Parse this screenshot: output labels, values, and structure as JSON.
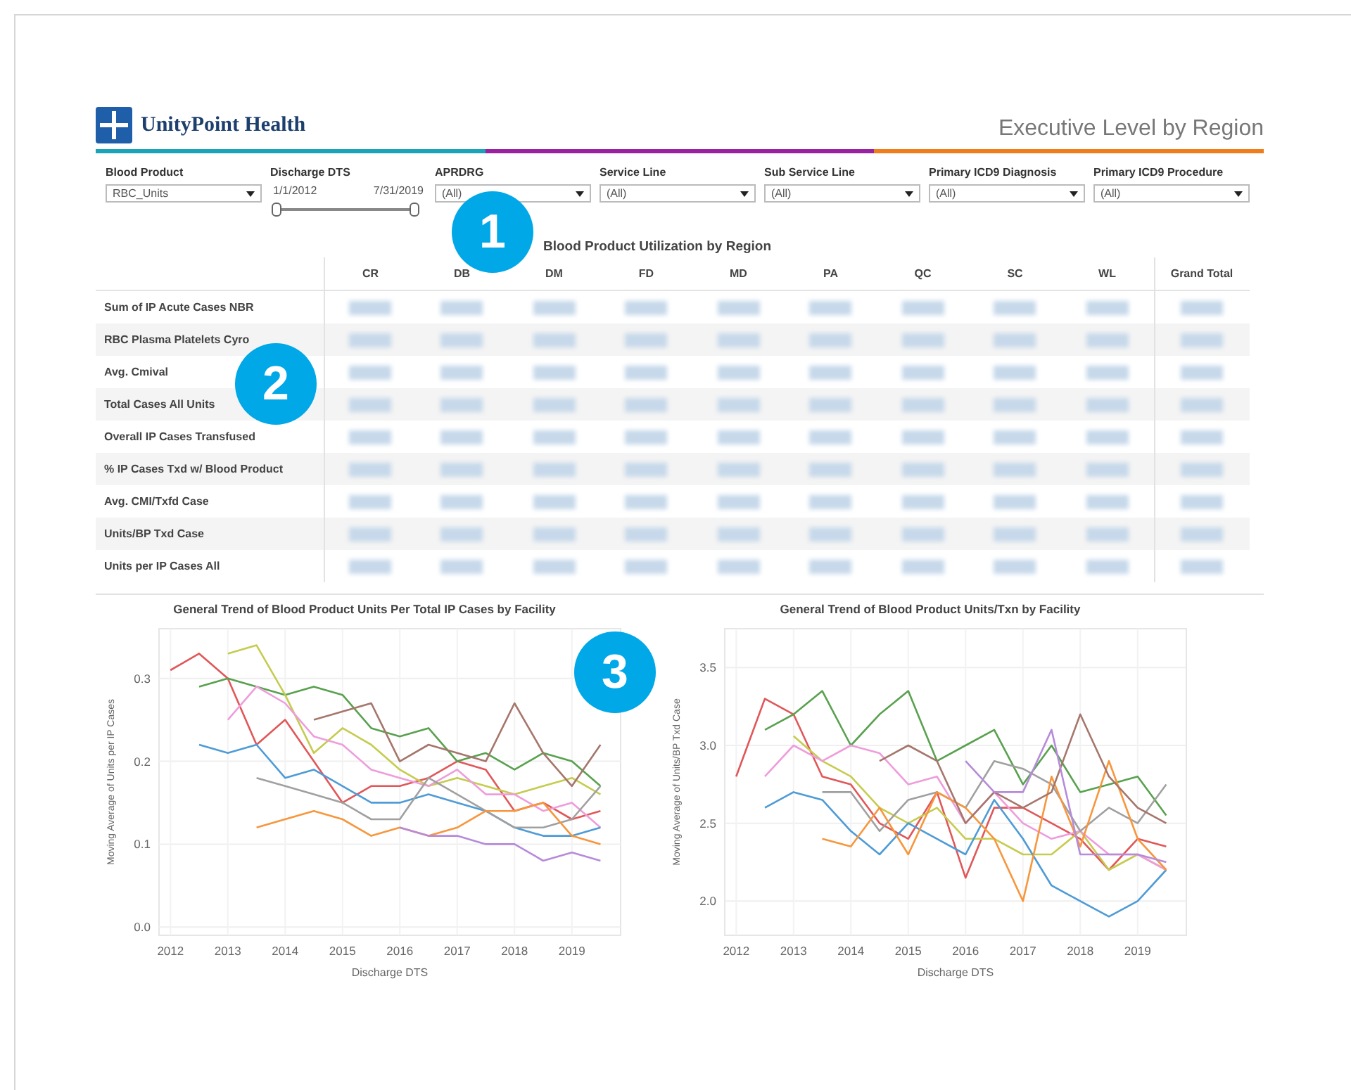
{
  "header": {
    "logo_text": "UnityPoint Health",
    "title": "Executive Level by Region"
  },
  "filters": [
    {
      "kind": "dropdown",
      "label": "Blood Product",
      "value": "RBC_Units"
    },
    {
      "kind": "range",
      "label": "Discharge DTS",
      "start": "1/1/2012",
      "end": "7/31/2019",
      "handles": [
        {
          "level": 0
        },
        {
          "level": 1
        }
      ]
    },
    {
      "kind": "dropdown",
      "label": "APRDRG",
      "value": "(All)"
    },
    {
      "kind": "dropdown",
      "label": "Service Line",
      "value": "(All)"
    },
    {
      "kind": "dropdown",
      "label": "Sub Service Line",
      "value": "(All)"
    },
    {
      "kind": "dropdown",
      "label": "Primary ICD9 Diagnosis",
      "value": "(All)"
    },
    {
      "kind": "dropdown",
      "label": "Primary ICD9 Procedure",
      "value": "(All)"
    }
  ],
  "table": {
    "title": "Blood Product Utilization by Region",
    "columns": [
      "CR",
      "DB",
      "DM",
      "FD",
      "MD",
      "PA",
      "QC",
      "SC",
      "WL",
      "Grand Total"
    ],
    "rows": [
      "Sum of IP Acute Cases NBR",
      "RBC Plasma Platelets Cyro",
      "Avg. Cmival",
      "Total Cases All Units",
      "Overall IP Cases Transfused",
      "% IP Cases Txd w/ Blood Product",
      "Avg. CMI/Txfd Case",
      "Units/BP Txd Case",
      "Units per IP Cases All"
    ]
  },
  "charts": [
    {
      "title": "General Trend of Blood Product Units Per Total IP Cases by Facility",
      "chart_data": {
        "type": "line",
        "grid": true,
        "xlabel": "Discharge DTS",
        "ylabel": "Moving Average of Units per IP Cases",
        "x": [
          2012,
          2012.5,
          2013,
          2013.5,
          2014,
          2014.5,
          2015,
          2015.5,
          2016,
          2016.5,
          2017,
          2017.5,
          2018,
          2018.5,
          2019,
          2019.5
        ],
        "xlim": [
          2011.8,
          2019.85
        ],
        "ylim": [
          -0.01,
          0.36
        ],
        "xticks": [
          2012,
          2013,
          2014,
          2015,
          2016,
          2017,
          2018,
          2019
        ],
        "yticks": [
          {
            "value": 0,
            "label": "0.0"
          },
          {
            "value": 0.1,
            "label": "0.1"
          },
          {
            "value": 0.2,
            "label": "0.2"
          },
          {
            "value": 0.3,
            "label": "0.3"
          }
        ],
        "series": [
          {
            "color": "#e15759",
            "values": [
              0.31,
              0.33,
              0.3,
              0.22,
              0.25,
              0.2,
              0.15,
              0.17,
              0.17,
              0.18,
              0.2,
              0.19,
              0.14,
              0.15,
              0.13,
              0.14
            ]
          },
          {
            "color": "#59a14f",
            "values": [
              null,
              0.29,
              0.3,
              0.29,
              0.28,
              0.29,
              0.28,
              0.24,
              0.23,
              0.24,
              0.2,
              0.21,
              0.19,
              0.21,
              0.2,
              0.17
            ]
          },
          {
            "color": "#c5cc4f",
            "values": [
              null,
              null,
              0.33,
              0.34,
              0.28,
              0.21,
              0.24,
              0.22,
              0.19,
              0.17,
              0.18,
              0.17,
              0.16,
              0.17,
              0.18,
              0.16
            ]
          },
          {
            "color": "#ee9ddb",
            "values": [
              null,
              null,
              0.25,
              0.29,
              0.27,
              0.23,
              0.22,
              0.19,
              0.18,
              0.17,
              0.19,
              0.16,
              0.16,
              0.14,
              0.15,
              0.12
            ]
          },
          {
            "color": "#4e9bd6",
            "values": [
              null,
              0.22,
              0.21,
              0.22,
              0.18,
              0.19,
              0.17,
              0.15,
              0.15,
              0.16,
              0.15,
              0.14,
              0.12,
              0.11,
              0.11,
              0.12
            ]
          },
          {
            "color": "#a0a0a0",
            "values": [
              null,
              null,
              null,
              0.18,
              0.17,
              0.16,
              0.15,
              0.13,
              0.13,
              0.18,
              0.16,
              0.14,
              0.12,
              0.12,
              0.13,
              0.17
            ]
          },
          {
            "color": "#f7963c",
            "values": [
              null,
              null,
              null,
              0.12,
              0.13,
              0.14,
              0.13,
              0.11,
              0.12,
              0.11,
              0.12,
              0.14,
              0.14,
              0.15,
              0.11,
              0.1
            ]
          },
          {
            "color": "#a6766c",
            "values": [
              null,
              null,
              null,
              null,
              null,
              0.25,
              0.26,
              0.27,
              0.2,
              0.22,
              0.21,
              0.2,
              0.27,
              0.21,
              0.17,
              0.22
            ]
          },
          {
            "color": "#b68bd9",
            "values": [
              null,
              null,
              null,
              null,
              null,
              null,
              null,
              null,
              0.12,
              0.11,
              0.11,
              0.1,
              0.1,
              0.08,
              0.09,
              0.08
            ]
          }
        ]
      }
    },
    {
      "title": "General Trend of Blood Product Units/Txn by Facility",
      "chart_data": {
        "type": "line",
        "grid": true,
        "xlabel": "Discharge DTS",
        "ylabel": "Moving Average of Units/BP Txd Case",
        "x": [
          2012,
          2012.5,
          2013,
          2013.5,
          2014,
          2014.5,
          2015,
          2015.5,
          2016,
          2016.5,
          2017,
          2017.5,
          2018,
          2018.5,
          2019,
          2019.5
        ],
        "xlim": [
          2011.8,
          2019.85
        ],
        "ylim": [
          1.78,
          3.75
        ],
        "xticks": [
          2012,
          2013,
          2014,
          2015,
          2016,
          2017,
          2018,
          2019
        ],
        "yticks": [
          {
            "value": 2,
            "label": "2.0"
          },
          {
            "value": 2.5,
            "label": "2.5"
          },
          {
            "value": 3,
            "label": "3.0"
          },
          {
            "value": 3.5,
            "label": "3.5"
          }
        ],
        "series": [
          {
            "color": "#e15759",
            "values": [
              2.8,
              3.3,
              3.2,
              2.8,
              2.75,
              2.5,
              2.4,
              2.7,
              2.15,
              2.6,
              2.6,
              2.5,
              2.4,
              2.2,
              2.4,
              2.35
            ]
          },
          {
            "color": "#59a14f",
            "values": [
              null,
              3.1,
              3.2,
              3.35,
              3.0,
              3.2,
              3.35,
              2.9,
              3.0,
              3.1,
              2.75,
              3.0,
              2.7,
              2.75,
              2.8,
              2.55
            ]
          },
          {
            "color": "#c5cc4f",
            "values": [
              null,
              null,
              3.06,
              2.9,
              2.8,
              2.6,
              2.5,
              2.6,
              2.4,
              2.4,
              2.3,
              2.3,
              2.45,
              2.2,
              2.3,
              2.2
            ]
          },
          {
            "color": "#ee9ddb",
            "values": [
              null,
              2.8,
              3.0,
              2.9,
              3.0,
              2.95,
              2.75,
              2.8,
              2.5,
              2.7,
              2.5,
              2.4,
              2.45,
              2.3,
              2.3,
              2.2
            ]
          },
          {
            "color": "#4e9bd6",
            "values": [
              null,
              2.6,
              2.7,
              2.65,
              2.45,
              2.3,
              2.5,
              2.4,
              2.3,
              2.65,
              2.4,
              2.1,
              2.0,
              1.9,
              2.0,
              2.2
            ]
          },
          {
            "color": "#a0a0a0",
            "values": [
              null,
              null,
              null,
              2.7,
              2.7,
              2.45,
              2.65,
              2.7,
              2.6,
              2.9,
              2.85,
              2.75,
              2.45,
              2.6,
              2.5,
              2.75
            ]
          },
          {
            "color": "#f7963c",
            "values": [
              null,
              null,
              null,
              2.4,
              2.35,
              2.6,
              2.3,
              2.7,
              2.6,
              2.4,
              2.0,
              2.8,
              2.35,
              2.9,
              2.4,
              2.2
            ]
          },
          {
            "color": "#a6766c",
            "values": [
              null,
              null,
              null,
              null,
              null,
              2.9,
              3.0,
              2.9,
              2.5,
              2.7,
              2.6,
              2.7,
              3.2,
              2.8,
              2.6,
              2.5
            ]
          },
          {
            "color": "#b68bd9",
            "values": [
              null,
              null,
              null,
              null,
              null,
              null,
              null,
              null,
              2.9,
              2.7,
              2.7,
              3.1,
              2.3,
              2.3,
              2.3,
              2.25
            ]
          }
        ]
      }
    }
  ],
  "callouts": [
    "1",
    "2",
    "3"
  ]
}
